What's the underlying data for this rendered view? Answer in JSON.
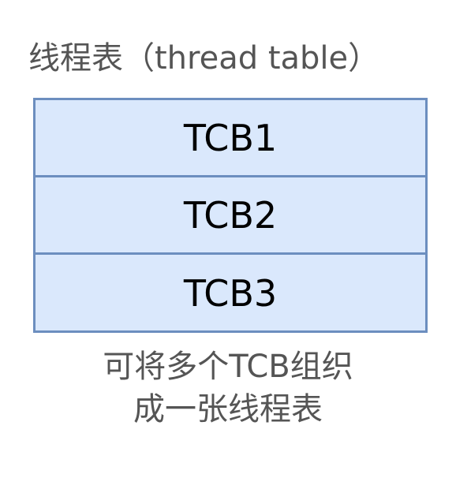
{
  "title": "线程表（thread table）",
  "table": {
    "rows": [
      "TCB1",
      "TCB2",
      "TCB3"
    ]
  },
  "caption": {
    "line1": "可将多个TCB组织",
    "line2": "成一张线程表"
  },
  "colors": {
    "table_fill": "#dae8fc",
    "table_border": "#6c8ebf",
    "label_text": "#555555"
  }
}
